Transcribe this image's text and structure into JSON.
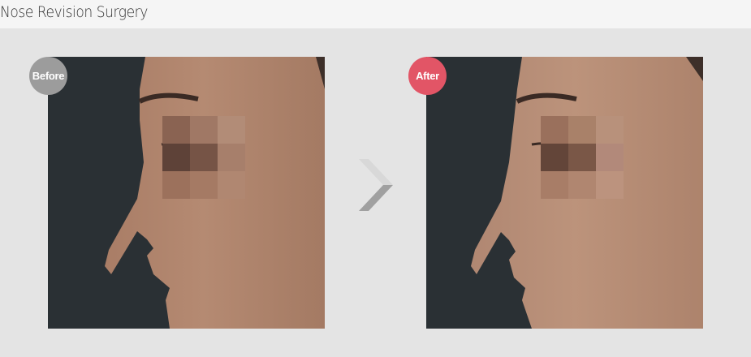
{
  "page": {
    "title": "Nose Revision Surgery"
  },
  "before": {
    "badge": "Before",
    "badge_color": "#9c9c9c"
  },
  "after": {
    "badge": "After",
    "badge_color": "#e25566"
  },
  "arrow": {
    "icon": "chevron-right-icon"
  }
}
